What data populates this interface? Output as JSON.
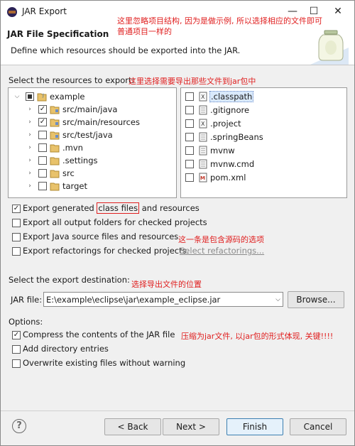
{
  "window": {
    "title": "JAR Export",
    "minimize": "—",
    "maximize": "☐",
    "close": "✕"
  },
  "header": {
    "title": "JAR File Specification",
    "description": "Define which resources should be exported into the JAR."
  },
  "annotations": {
    "top": "这里忽略项目结构, 因为是做示例, 所以选择相应的文件即可",
    "top2": "普通项目一样的",
    "select": "这里选择需要导出那些文件到jar包中",
    "source": "这一条是包含源码的选项",
    "dest": "选择导出文件的位置",
    "compress": "压缩为jar文件, 以jar包的形式体现, 关键!!!!"
  },
  "resources": {
    "label": "Select the resources to export:",
    "tree": [
      {
        "label": "example",
        "checked": "partial",
        "expanded": true
      },
      {
        "label": "src/main/java",
        "checked": true
      },
      {
        "label": "src/main/resources",
        "checked": true
      },
      {
        "label": "src/test/java",
        "checked": false
      },
      {
        "label": ".mvn",
        "checked": false
      },
      {
        "label": ".settings",
        "checked": false
      },
      {
        "label": "src",
        "checked": false
      },
      {
        "label": "target",
        "checked": false
      }
    ],
    "files": [
      {
        "label": ".classpath",
        "checked": false,
        "icon": "x-file-icon"
      },
      {
        "label": ".gitignore",
        "checked": false,
        "icon": "file-icon"
      },
      {
        "label": ".project",
        "checked": false,
        "icon": "x-file-icon"
      },
      {
        "label": ".springBeans",
        "checked": false,
        "icon": "file-icon"
      },
      {
        "label": "mvnw",
        "checked": false,
        "icon": "file-icon"
      },
      {
        "label": "mvnw.cmd",
        "checked": false,
        "icon": "file-icon"
      },
      {
        "label": "pom.xml",
        "checked": false,
        "icon": "maven-file-icon"
      }
    ]
  },
  "export_options": {
    "generated_pre": "Export generated ",
    "generated_mid": "class files",
    "generated_post": " and resources",
    "output_folders": "Export all output folders for checked projects",
    "java_source": "Export Java source files and resources",
    "refactorings": "Export refactorings for checked projects.",
    "select_refactorings": "Select refactorings..."
  },
  "destination": {
    "label": "Select the export destination:",
    "jar_label": "JAR file:",
    "jar_value": "E:\\example\\eclipse\\jar\\example_eclipse.jar",
    "browse": "Browse..."
  },
  "options": {
    "label": "Options:",
    "compress": "Compress the contents of the JAR file",
    "directory_entries": "Add directory entries",
    "overwrite": "Overwrite existing files without warning"
  },
  "footer": {
    "help": "?",
    "back": "< Back",
    "next": "Next >",
    "finish": "Finish",
    "cancel": "Cancel"
  }
}
